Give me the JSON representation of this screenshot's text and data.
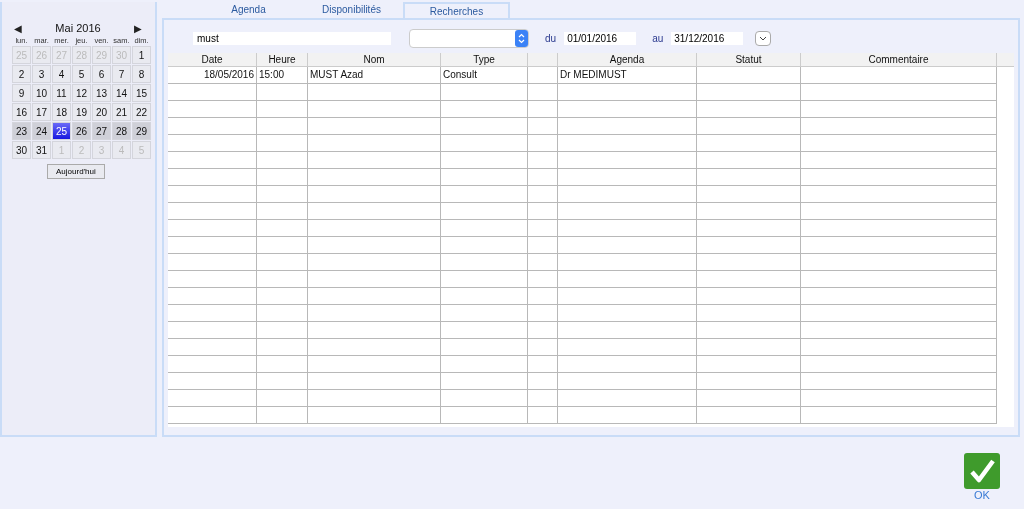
{
  "calendar": {
    "prev": "◀",
    "month": "Mai 2016",
    "next": "▶",
    "weekdays": [
      "lun.",
      "mar.",
      "mer.",
      "jeu.",
      "ven.",
      "sam.",
      "dim."
    ],
    "weeks": [
      {
        "current": false,
        "days": [
          {
            "label": "25",
            "muted": true,
            "selected": false
          },
          {
            "label": "26",
            "muted": true,
            "selected": false
          },
          {
            "label": "27",
            "muted": true,
            "selected": false
          },
          {
            "label": "28",
            "muted": true,
            "selected": false
          },
          {
            "label": "29",
            "muted": true,
            "selected": false
          },
          {
            "label": "30",
            "muted": true,
            "selected": false
          },
          {
            "label": "1",
            "muted": false,
            "selected": false
          }
        ]
      },
      {
        "current": false,
        "days": [
          {
            "label": "2",
            "muted": false,
            "selected": false
          },
          {
            "label": "3",
            "muted": false,
            "selected": false
          },
          {
            "label": "4",
            "muted": false,
            "selected": false
          },
          {
            "label": "5",
            "muted": false,
            "selected": false
          },
          {
            "label": "6",
            "muted": false,
            "selected": false
          },
          {
            "label": "7",
            "muted": false,
            "selected": false
          },
          {
            "label": "8",
            "muted": false,
            "selected": false
          }
        ]
      },
      {
        "current": false,
        "days": [
          {
            "label": "9",
            "muted": false,
            "selected": false
          },
          {
            "label": "10",
            "muted": false,
            "selected": false
          },
          {
            "label": "11",
            "muted": false,
            "selected": false
          },
          {
            "label": "12",
            "muted": false,
            "selected": false
          },
          {
            "label": "13",
            "muted": false,
            "selected": false
          },
          {
            "label": "14",
            "muted": false,
            "selected": false
          },
          {
            "label": "15",
            "muted": false,
            "selected": false
          }
        ]
      },
      {
        "current": false,
        "days": [
          {
            "label": "16",
            "muted": false,
            "selected": false
          },
          {
            "label": "17",
            "muted": false,
            "selected": false
          },
          {
            "label": "18",
            "muted": false,
            "selected": false
          },
          {
            "label": "19",
            "muted": false,
            "selected": false
          },
          {
            "label": "20",
            "muted": false,
            "selected": false
          },
          {
            "label": "21",
            "muted": false,
            "selected": false
          },
          {
            "label": "22",
            "muted": false,
            "selected": false
          }
        ]
      },
      {
        "current": true,
        "days": [
          {
            "label": "23",
            "muted": false,
            "selected": false
          },
          {
            "label": "24",
            "muted": false,
            "selected": false
          },
          {
            "label": "25",
            "muted": false,
            "selected": true
          },
          {
            "label": "26",
            "muted": false,
            "selected": false
          },
          {
            "label": "27",
            "muted": false,
            "selected": false
          },
          {
            "label": "28",
            "muted": false,
            "selected": false
          },
          {
            "label": "29",
            "muted": false,
            "selected": false
          }
        ]
      },
      {
        "current": false,
        "days": [
          {
            "label": "30",
            "muted": false,
            "selected": false
          },
          {
            "label": "31",
            "muted": false,
            "selected": false
          },
          {
            "label": "1",
            "muted": true,
            "selected": false
          },
          {
            "label": "2",
            "muted": true,
            "selected": false
          },
          {
            "label": "3",
            "muted": true,
            "selected": false
          },
          {
            "label": "4",
            "muted": true,
            "selected": false
          },
          {
            "label": "5",
            "muted": true,
            "selected": false
          }
        ]
      }
    ],
    "today_button": "Aujourd'hui"
  },
  "tabs": [
    {
      "label": "Agenda",
      "selected": false
    },
    {
      "label": "Disponibilités",
      "selected": false
    },
    {
      "label": "Recherches",
      "selected": true
    }
  ],
  "search": {
    "value": "must",
    "from_label": "du",
    "from": "01/01/2016",
    "to_label": "au",
    "to": "31/12/2016"
  },
  "table": {
    "columns": [
      "Date",
      "Heure",
      "Nom",
      "Type",
      "",
      "Agenda",
      "Statut",
      "Commentaire"
    ],
    "rows": [
      [
        "18/05/2016",
        "15:00",
        "MUST Azad",
        "Consult",
        "",
        "Dr MEDIMUST",
        "",
        ""
      ]
    ]
  },
  "ok_button": "OK"
}
